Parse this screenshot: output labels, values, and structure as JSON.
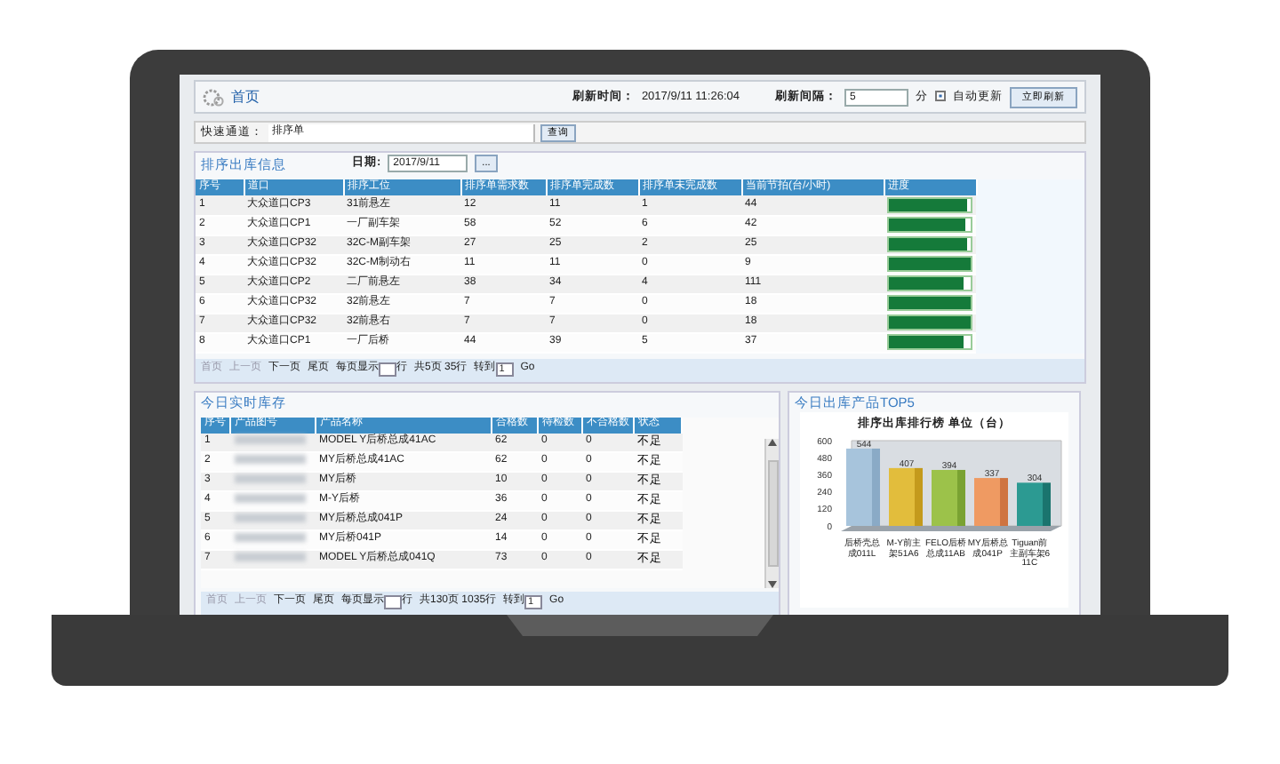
{
  "header": {
    "title": "首页",
    "refresh_label": "刷新时间：",
    "refresh_time": "2017/9/11 11:26:04",
    "interval_label": "刷新间隔：",
    "interval_value": "5",
    "interval_unit": "分",
    "auto_update": {
      "label": "自动更新",
      "checked": true
    },
    "refresh_button": "立即刷新"
  },
  "quick_access": {
    "label": "快速通道：",
    "value": "排序单",
    "button": "查询"
  },
  "sorting": {
    "title": "排序出库信息",
    "date_label": "日期:",
    "date_value": "2017/9/11",
    "date_button": "...",
    "columns": [
      "序号",
      "道口",
      "排序工位",
      "排序单需求数",
      "排序单完成数",
      "排序单未完成数",
      "当前节拍(台/小时)",
      "进度"
    ],
    "rows": [
      {
        "cells": [
          "1",
          "大众道口CP3",
          "31前悬左",
          "12",
          "11",
          "1",
          "44"
        ],
        "level": 0.95
      },
      {
        "cells": [
          "2",
          "大众道口CP1",
          "一厂副车架",
          "58",
          "52",
          "6",
          "42"
        ],
        "level": 0.93
      },
      {
        "cells": [
          "3",
          "大众道口CP32",
          "32C-M副车架",
          "27",
          "25",
          "2",
          "25"
        ],
        "level": 0.95
      },
      {
        "cells": [
          "4",
          "大众道口CP32",
          "32C-M制动右",
          "11",
          "11",
          "0",
          "9"
        ],
        "level": 1
      },
      {
        "cells": [
          "5",
          "大众道口CP2",
          "二厂前悬左",
          "38",
          "34",
          "4",
          "111"
        ],
        "level": 0.92
      },
      {
        "cells": [
          "6",
          "大众道口CP32",
          "32前悬左",
          "7",
          "7",
          "0",
          "18"
        ],
        "level": 1
      },
      {
        "cells": [
          "7",
          "大众道口CP32",
          "32前悬右",
          "7",
          "7",
          "0",
          "18"
        ],
        "level": 1
      },
      {
        "cells": [
          "8",
          "大众道口CP1",
          "一厂后桥",
          "44",
          "39",
          "5",
          "37"
        ],
        "level": 0.92
      }
    ],
    "pager": {
      "links": [
        {
          "label": "首页",
          "disabled": true
        },
        {
          "label": "上一页",
          "disabled": true
        },
        {
          "label": "下一页",
          "disabled": false
        },
        {
          "label": "尾页",
          "disabled": false
        }
      ],
      "per_page_label": "每页显示",
      "per_page_unit": "行",
      "summary": "共5页 35行",
      "goto_label": "转到",
      "goto_value": "1",
      "go": "Go"
    }
  },
  "inventory": {
    "title": "今日实时库存",
    "columns": [
      "序号",
      "产品图号",
      "产品名称",
      "合格数",
      "待检数",
      "不合格数",
      "状态"
    ],
    "rows": [
      {
        "no": "1",
        "name": "MODEL Y后桥总成41AC",
        "qualified": "62",
        "pending": "0",
        "unqualified": "0",
        "status": "不足",
        "kind": "short"
      },
      {
        "no": "2",
        "name": "MY后桥总成41AC",
        "qualified": "62",
        "pending": "0",
        "unqualified": "0",
        "status": "不足",
        "kind": "short"
      },
      {
        "no": "3",
        "name": "MY后桥",
        "qualified": "10",
        "pending": "0",
        "unqualified": "0",
        "status": "不足",
        "kind": "short"
      },
      {
        "no": "4",
        "name": "M-Y后桥",
        "qualified": "36",
        "pending": "0",
        "unqualified": "0",
        "status": "不足",
        "kind": "short"
      },
      {
        "no": "5",
        "name": "MY后桥总成041P",
        "qualified": "24",
        "pending": "0",
        "unqualified": "0",
        "status": "不足",
        "kind": "short"
      },
      {
        "no": "6",
        "name": "MY后桥041P",
        "qualified": "14",
        "pending": "0",
        "unqualified": "0",
        "status": "不足",
        "kind": "short"
      },
      {
        "no": "7",
        "name": "MODEL Y后桥总成041Q",
        "qualified": "73",
        "pending": "0",
        "unqualified": "0",
        "status": "不足",
        "kind": "short"
      }
    ],
    "pager": {
      "links": [
        {
          "label": "首页",
          "disabled": true
        },
        {
          "label": "上一页",
          "disabled": true
        },
        {
          "label": "下一页",
          "disabled": false
        },
        {
          "label": "尾页",
          "disabled": false
        }
      ],
      "per_page_label": "每页显示",
      "per_page_unit": "行",
      "summary": "共130页 1035行",
      "goto_label": "转到",
      "goto_value": "1",
      "go": "Go"
    }
  },
  "top5": {
    "title": "今日出库产品TOP5",
    "chart_data": {
      "type": "bar",
      "title": "排序出库排行榜 单位（台）",
      "categories": [
        "后桥壳总成011L",
        "M-Y前主架51A6",
        "FELO后桥总成11AB",
        "MY后桥总成041P",
        "Tiguan前主副车架611C"
      ],
      "values": [
        544,
        407,
        394,
        337,
        304
      ],
      "ylim": [
        0,
        600
      ],
      "yticks": [
        0,
        120,
        240,
        360,
        480,
        600
      ],
      "data_labels": true
    }
  }
}
